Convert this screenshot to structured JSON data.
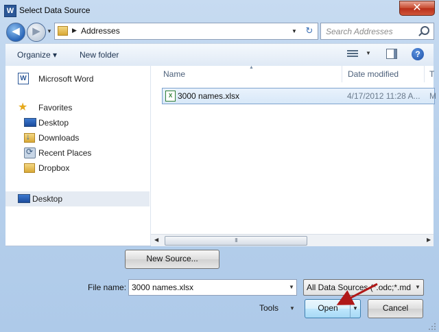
{
  "window": {
    "title": "Select Data Source",
    "app_icon_letter": "W",
    "close_glyph": "✕"
  },
  "address": {
    "back_glyph": "◀",
    "forward_glyph": "▶",
    "path": "Addresses",
    "refresh_glyph": "↻"
  },
  "search": {
    "placeholder": "Search Addresses"
  },
  "toolbar": {
    "organize_label": "Organize ▾",
    "new_folder_label": "New folder"
  },
  "nav": {
    "items": [
      {
        "label": "Microsoft Word",
        "icon": "word-icon"
      },
      {
        "label": "Favorites",
        "icon": "star-icon"
      },
      {
        "label": "Desktop",
        "icon": "desktop-icon"
      },
      {
        "label": "Downloads",
        "icon": "downloads-folder-icon"
      },
      {
        "label": "Recent Places",
        "icon": "recent-places-icon"
      },
      {
        "label": "Dropbox",
        "icon": "folder-icon"
      },
      {
        "label": "Desktop",
        "icon": "desktop-icon",
        "selected": true
      }
    ]
  },
  "file_list": {
    "columns": [
      "Name",
      "Date modified",
      "T"
    ],
    "rows": [
      {
        "name": "3000 names.xlsx",
        "date_modified": "4/17/2012 11:28 A...",
        "type": "M",
        "icon": "excel-file-icon",
        "selected": true
      }
    ],
    "scroll_thumb_grip": "III"
  },
  "bottom": {
    "new_source_label": "New Source...",
    "file_name_label": "File name:",
    "file_name_value": "3000 names.xlsx",
    "filter_value": "All Data Sources (*.odc;*.md",
    "tools_label": "Tools",
    "open_label": "Open",
    "cancel_label": "Cancel"
  },
  "colors": {
    "annotation_arrow": "#b01818",
    "selection": "#d8e8f8",
    "frame": "#b9d1ec"
  }
}
